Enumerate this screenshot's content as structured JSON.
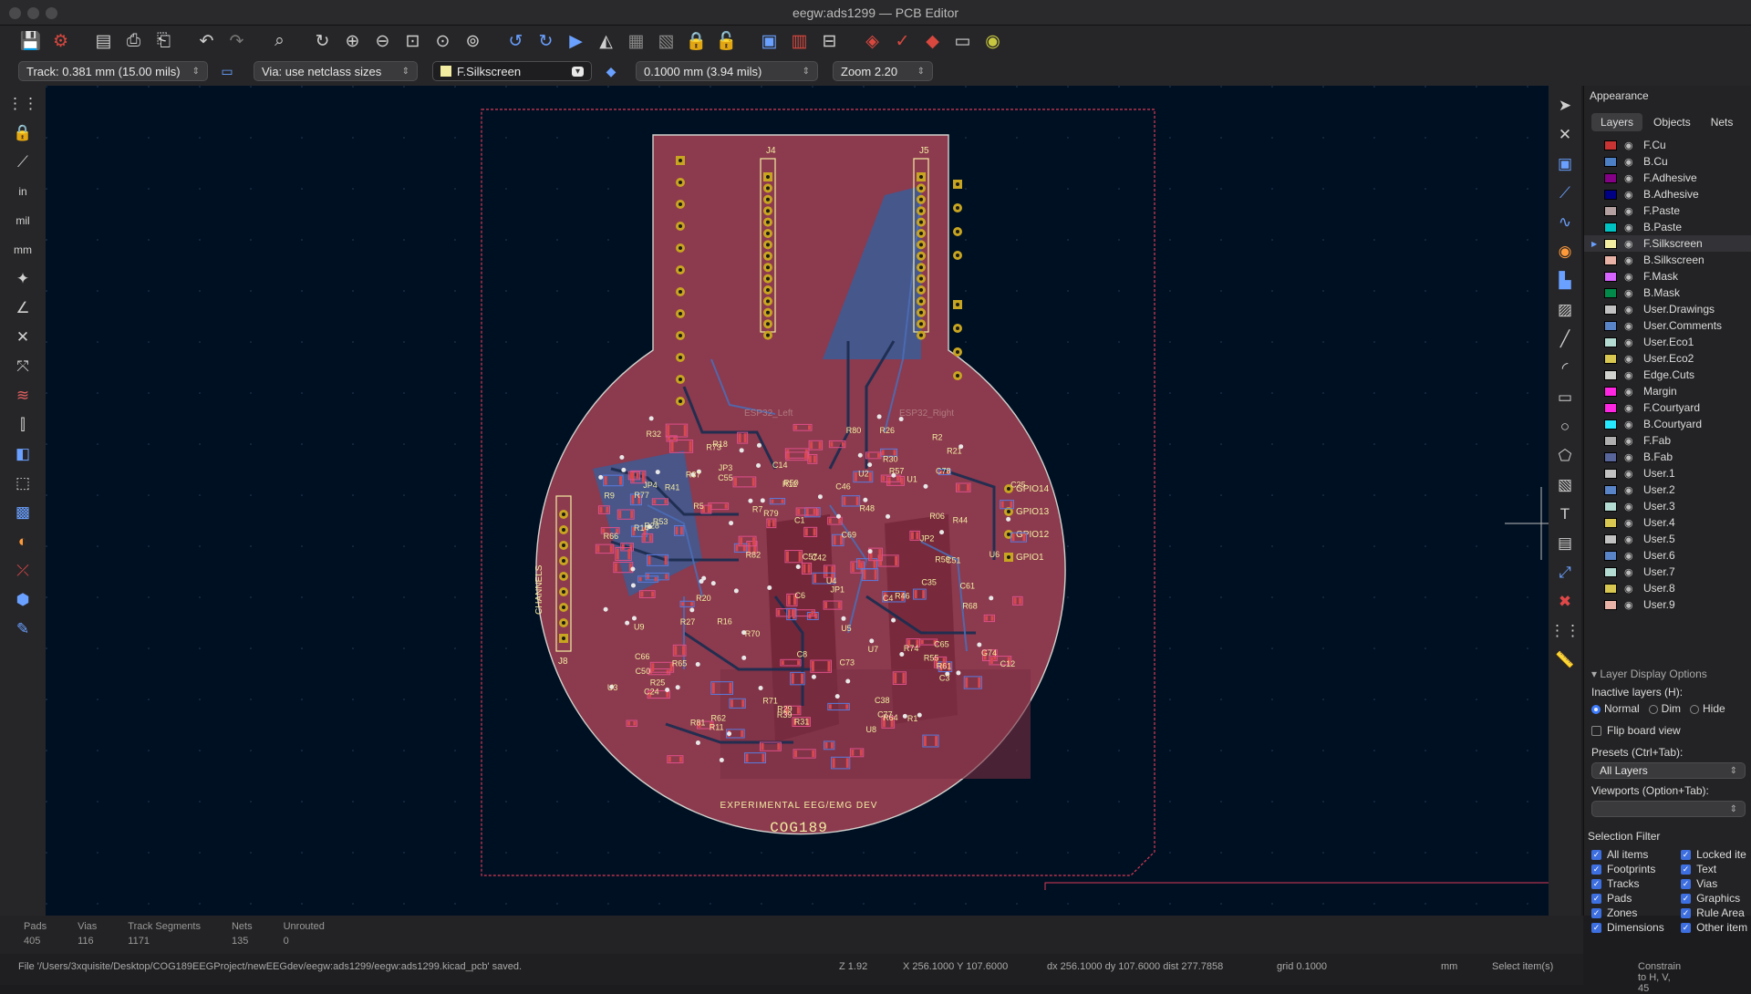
{
  "window": {
    "title": "eegw:ads1299 — PCB Editor"
  },
  "options": {
    "track": "Track: 0.381 mm (15.00 mils)",
    "via": "Via: use netclass sizes",
    "layer": "F.Silkscreen",
    "grid": "0.1000 mm (3.94 mils)",
    "zoom": "Zoom 2.20"
  },
  "appearance": {
    "title": "Appearance",
    "tabs": [
      "Layers",
      "Objects",
      "Nets"
    ],
    "layers": [
      {
        "name": "F.Cu",
        "color": "#c83434"
      },
      {
        "name": "B.Cu",
        "color": "#4d7fc4"
      },
      {
        "name": "F.Adhesive",
        "color": "#840084"
      },
      {
        "name": "B.Adhesive",
        "color": "#000084"
      },
      {
        "name": "F.Paste",
        "color": "#b4a0a0"
      },
      {
        "name": "B.Paste",
        "color": "#00c2c2"
      },
      {
        "name": "F.Silkscreen",
        "color": "#f2eda1"
      },
      {
        "name": "B.Silkscreen",
        "color": "#e8b2a7"
      },
      {
        "name": "F.Mask",
        "color": "#d864ff"
      },
      {
        "name": "B.Mask",
        "color": "#028a4a"
      },
      {
        "name": "User.Drawings",
        "color": "#c2c2c2"
      },
      {
        "name": "User.Comments",
        "color": "#5985c8"
      },
      {
        "name": "User.Eco1",
        "color": "#b4dbd2"
      },
      {
        "name": "User.Eco2",
        "color": "#d8c852"
      },
      {
        "name": "Edge.Cuts",
        "color": "#d0d2cd"
      },
      {
        "name": "Margin",
        "color": "#ff26e2"
      },
      {
        "name": "F.Courtyard",
        "color": "#ff26e2"
      },
      {
        "name": "B.Courtyard",
        "color": "#26e9ff"
      },
      {
        "name": "F.Fab",
        "color": "#afafaf"
      },
      {
        "name": "B.Fab",
        "color": "#58659b"
      },
      {
        "name": "User.1",
        "color": "#c2c2c2"
      },
      {
        "name": "User.2",
        "color": "#5985c8"
      },
      {
        "name": "User.3",
        "color": "#b4dbd2"
      },
      {
        "name": "User.4",
        "color": "#d8c852"
      },
      {
        "name": "User.5",
        "color": "#c2c2c2"
      },
      {
        "name": "User.6",
        "color": "#5985c8"
      },
      {
        "name": "User.7",
        "color": "#b4dbd2"
      },
      {
        "name": "User.8",
        "color": "#d8c852"
      },
      {
        "name": "User.9",
        "color": "#e8b2a7"
      }
    ],
    "layer_display_options": "Layer Display Options",
    "inactive_layers": "Inactive layers (H):",
    "inactive_options": [
      "Normal",
      "Dim",
      "Hide"
    ],
    "flip_board": "Flip board view",
    "presets_label": "Presets (Ctrl+Tab):",
    "presets_value": "All Layers",
    "viewports_label": "Viewports (Option+Tab):",
    "selection_filter": "Selection Filter",
    "filters_left": [
      "All items",
      "Footprints",
      "Tracks",
      "Pads",
      "Zones",
      "Dimensions"
    ],
    "filters_right": [
      "Locked ite",
      "Text",
      "Vias",
      "Graphics",
      "Rule Area",
      "Other item"
    ]
  },
  "board": {
    "silk_title": "EXPERIMENTAL EEG/EMG DEV",
    "silk_course": "COG189",
    "j4": "J4",
    "j5": "J5",
    "j8": "J8",
    "esp_left": "ESP32_Left",
    "esp_right": "ESP32_Right",
    "channels": "CHANNELS",
    "gpio": [
      "GPIO14",
      "GPIO13",
      "GPIO12",
      "GPIO1"
    ],
    "refs": [
      "R70",
      "C73",
      "G74",
      "R71",
      "R74",
      "U9",
      "R73",
      "R06",
      "C77",
      "R77",
      "C78",
      "C24",
      "C3",
      "C6",
      "R30",
      "U1",
      "R25",
      "R26",
      "R27",
      "R28",
      "R29",
      "JP1",
      "JP2",
      "JP3",
      "JP4",
      "R79",
      "R80",
      "R81",
      "R82",
      "C38",
      "R37",
      "R21",
      "C14",
      "U5",
      "R39",
      "R41",
      "C42",
      "R61",
      "C65",
      "C66",
      "R62",
      "U8",
      "R64",
      "R65",
      "R66",
      "C69",
      "R68",
      "C55",
      "R53",
      "U7",
      "R55",
      "R57",
      "C61",
      "R59",
      "C46",
      "R44",
      "R46",
      "C50",
      "U6",
      "C51",
      "R48",
      "R50",
      "C57",
      "R31",
      "R1",
      "U3",
      "C25",
      "R32",
      "R2",
      "C1",
      "C12",
      "R14",
      "R16",
      "U4",
      "R18",
      "C35",
      "R20",
      "C4",
      "R5",
      "R7",
      "U2",
      "R9",
      "R11",
      "R12",
      "C8"
    ]
  },
  "status": {
    "pads": {
      "label": "Pads",
      "value": "405"
    },
    "vias": {
      "label": "Vias",
      "value": "116"
    },
    "tracks": {
      "label": "Track Segments",
      "value": "1171"
    },
    "nets": {
      "label": "Nets",
      "value": "135"
    },
    "unrouted": {
      "label": "Unrouted",
      "value": "0"
    }
  },
  "message": {
    "file": "File '/Users/3xquisite/Desktop/COG189EEGProject/newEEGdev/eegw:ads1299/eegw:ads1299.kicad_pcb' saved.",
    "z": "Z 1.92",
    "xy": "X 256.1000  Y 107.6000",
    "dxy": "dx 256.1000  dy 107.6000  dist 277.7858",
    "grid": "grid 0.1000",
    "units": "mm",
    "mode": "Select item(s)",
    "constrain": "Constrain to H, V, 45"
  }
}
